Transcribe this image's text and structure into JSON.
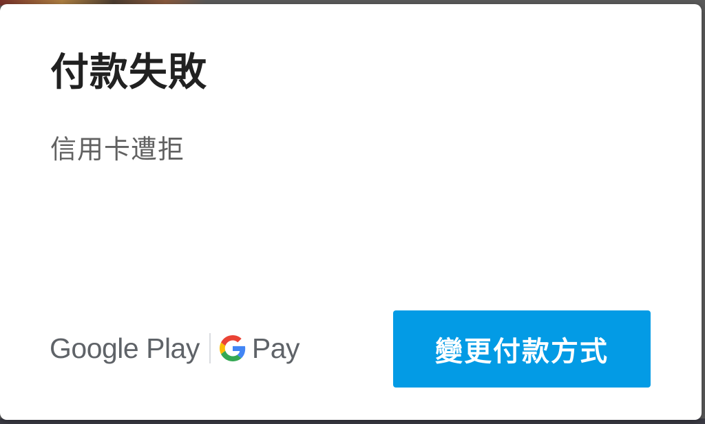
{
  "dialog": {
    "title": "付款失敗",
    "message": "信用卡遭拒"
  },
  "branding": {
    "google_play": "Google Play",
    "pay": "Pay",
    "g_logo_icon": "google-g-logo",
    "colors": {
      "text": "#5f6368",
      "g_blue": "#4285F4",
      "g_red": "#EA4335",
      "g_yellow": "#FBBC05",
      "g_green": "#34A853"
    }
  },
  "actions": {
    "change_payment_label": "變更付款方式",
    "button_color": "#039be5"
  }
}
